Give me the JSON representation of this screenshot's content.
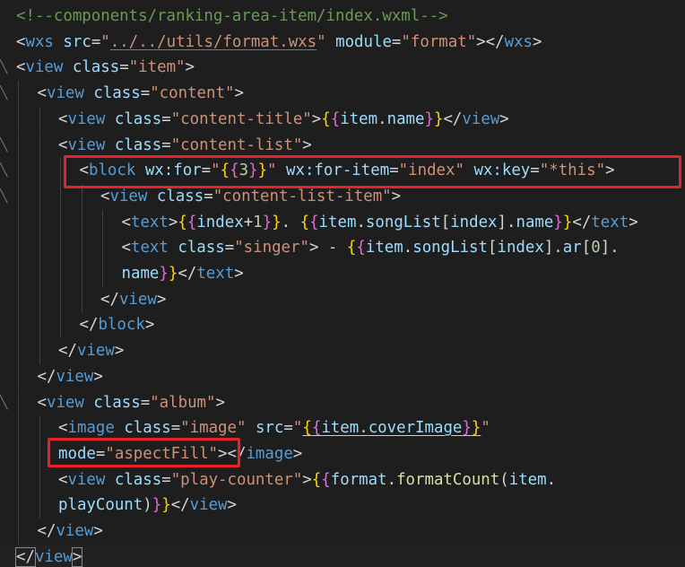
{
  "lines": [
    {
      "indent": 0,
      "fold": "",
      "tokens": [
        {
          "c": "t-comment",
          "t": "<!--components/ranking-area-item/index.wxml-->"
        }
      ]
    },
    {
      "indent": 0,
      "fold": "",
      "tokens": [
        {
          "c": "t-punc",
          "t": "<"
        },
        {
          "c": "t-tag",
          "t": "wxs"
        },
        {
          "c": "t-plain",
          "t": " "
        },
        {
          "c": "t-attr",
          "t": "src"
        },
        {
          "c": "t-plain",
          "t": "="
        },
        {
          "c": "t-str",
          "t": "\""
        },
        {
          "c": "t-str u-red",
          "t": "../../utils/format.wxs"
        },
        {
          "c": "t-str",
          "t": "\""
        },
        {
          "c": "t-plain",
          "t": " "
        },
        {
          "c": "t-attr",
          "t": "module"
        },
        {
          "c": "t-plain",
          "t": "="
        },
        {
          "c": "t-str",
          "t": "\"format\""
        },
        {
          "c": "t-punc",
          "t": "></"
        },
        {
          "c": "t-tag",
          "t": "wxs"
        },
        {
          "c": "t-punc",
          "t": ">"
        }
      ]
    },
    {
      "indent": 0,
      "fold": "v",
      "tokens": [
        {
          "c": "t-punc",
          "t": "<"
        },
        {
          "c": "t-tag",
          "t": "view"
        },
        {
          "c": "t-plain",
          "t": " "
        },
        {
          "c": "t-attr",
          "t": "class"
        },
        {
          "c": "t-plain",
          "t": "="
        },
        {
          "c": "t-str",
          "t": "\"item\""
        },
        {
          "c": "t-punc",
          "t": ">"
        }
      ]
    },
    {
      "indent": 1,
      "fold": "v",
      "tokens": [
        {
          "c": "t-punc",
          "t": "<"
        },
        {
          "c": "t-tag",
          "t": "view"
        },
        {
          "c": "t-plain",
          "t": " "
        },
        {
          "c": "t-attr",
          "t": "class"
        },
        {
          "c": "t-plain",
          "t": "="
        },
        {
          "c": "t-str",
          "t": "\"content\""
        },
        {
          "c": "t-punc",
          "t": ">"
        }
      ]
    },
    {
      "indent": 2,
      "fold": "",
      "tokens": [
        {
          "c": "t-punc",
          "t": "<"
        },
        {
          "c": "t-tag",
          "t": "view"
        },
        {
          "c": "t-plain",
          "t": " "
        },
        {
          "c": "t-attr",
          "t": "class"
        },
        {
          "c": "t-plain",
          "t": "="
        },
        {
          "c": "t-str",
          "t": "\"content-title\""
        },
        {
          "c": "t-punc",
          "t": ">"
        },
        {
          "c": "t-brace",
          "t": "{"
        },
        {
          "c": "t-brace2",
          "t": "{"
        },
        {
          "c": "t-var",
          "t": "item"
        },
        {
          "c": "t-plain",
          "t": "."
        },
        {
          "c": "t-var",
          "t": "name"
        },
        {
          "c": "t-brace2",
          "t": "}"
        },
        {
          "c": "t-brace",
          "t": "}"
        },
        {
          "c": "t-punc",
          "t": "</"
        },
        {
          "c": "t-tag",
          "t": "view"
        },
        {
          "c": "t-punc",
          "t": ">"
        }
      ]
    },
    {
      "indent": 2,
      "fold": "v",
      "tokens": [
        {
          "c": "t-punc",
          "t": "<"
        },
        {
          "c": "t-tag",
          "t": "view"
        },
        {
          "c": "t-plain",
          "t": " "
        },
        {
          "c": "t-attr",
          "t": "class"
        },
        {
          "c": "t-plain",
          "t": "="
        },
        {
          "c": "t-str",
          "t": "\"content-list\""
        },
        {
          "c": "t-punc",
          "t": ">"
        }
      ]
    },
    {
      "indent": 3,
      "fold": "v",
      "tokens": [
        {
          "c": "t-punc",
          "t": "<"
        },
        {
          "c": "t-tag",
          "t": "block"
        },
        {
          "c": "t-plain",
          "t": " "
        },
        {
          "c": "t-attr",
          "t": "wx:for"
        },
        {
          "c": "t-plain",
          "t": "="
        },
        {
          "c": "t-str",
          "t": "\""
        },
        {
          "c": "t-brace",
          "t": "{"
        },
        {
          "c": "t-brace2",
          "t": "{"
        },
        {
          "c": "t-num",
          "t": "3"
        },
        {
          "c": "t-brace2",
          "t": "}"
        },
        {
          "c": "t-brace",
          "t": "}"
        },
        {
          "c": "t-str",
          "t": "\""
        },
        {
          "c": "t-plain",
          "t": " "
        },
        {
          "c": "t-attr",
          "t": "wx:for-item"
        },
        {
          "c": "t-plain",
          "t": "="
        },
        {
          "c": "t-str",
          "t": "\"index\""
        },
        {
          "c": "t-plain",
          "t": " "
        },
        {
          "c": "t-attr",
          "t": "wx:key"
        },
        {
          "c": "t-plain",
          "t": "="
        },
        {
          "c": "t-str",
          "t": "\"*this\""
        },
        {
          "c": "t-punc",
          "t": ">"
        }
      ]
    },
    {
      "indent": 4,
      "fold": "v",
      "tokens": [
        {
          "c": "t-punc",
          "t": "<"
        },
        {
          "c": "t-tag",
          "t": "view"
        },
        {
          "c": "t-plain",
          "t": " "
        },
        {
          "c": "t-attr",
          "t": "class"
        },
        {
          "c": "t-plain",
          "t": "="
        },
        {
          "c": "t-str",
          "t": "\"content-list-item\""
        },
        {
          "c": "t-punc",
          "t": ">"
        }
      ]
    },
    {
      "indent": 5,
      "fold": "",
      "tokens": [
        {
          "c": "t-punc",
          "t": "<"
        },
        {
          "c": "t-tag",
          "t": "text"
        },
        {
          "c": "t-punc",
          "t": ">"
        },
        {
          "c": "t-brace",
          "t": "{"
        },
        {
          "c": "t-brace2",
          "t": "{"
        },
        {
          "c": "t-var",
          "t": "index"
        },
        {
          "c": "t-plain",
          "t": "+"
        },
        {
          "c": "t-num",
          "t": "1"
        },
        {
          "c": "t-brace2",
          "t": "}"
        },
        {
          "c": "t-brace",
          "t": "}"
        },
        {
          "c": "t-text",
          "t": ". "
        },
        {
          "c": "t-brace",
          "t": "{"
        },
        {
          "c": "t-brace2",
          "t": "{"
        },
        {
          "c": "t-var",
          "t": "item"
        },
        {
          "c": "t-plain",
          "t": "."
        },
        {
          "c": "t-var",
          "t": "songList"
        },
        {
          "c": "t-plain",
          "t": "["
        },
        {
          "c": "t-var",
          "t": "index"
        },
        {
          "c": "t-plain",
          "t": "]."
        },
        {
          "c": "t-var",
          "t": "name"
        },
        {
          "c": "t-brace2",
          "t": "}"
        },
        {
          "c": "t-brace",
          "t": "}"
        },
        {
          "c": "t-punc",
          "t": "</"
        },
        {
          "c": "t-tag",
          "t": "text"
        },
        {
          "c": "t-punc",
          "t": ">"
        }
      ]
    },
    {
      "indent": 5,
      "fold": "",
      "tokens": [
        {
          "c": "t-punc",
          "t": "<"
        },
        {
          "c": "t-tag",
          "t": "text"
        },
        {
          "c": "t-plain",
          "t": " "
        },
        {
          "c": "t-attr",
          "t": "class"
        },
        {
          "c": "t-plain",
          "t": "="
        },
        {
          "c": "t-str",
          "t": "\"singer\""
        },
        {
          "c": "t-punc",
          "t": ">"
        },
        {
          "c": "t-text",
          "t": " - "
        },
        {
          "c": "t-brace",
          "t": "{"
        },
        {
          "c": "t-brace2",
          "t": "{"
        },
        {
          "c": "t-var",
          "t": "item"
        },
        {
          "c": "t-plain",
          "t": "."
        },
        {
          "c": "t-var",
          "t": "songList"
        },
        {
          "c": "t-plain",
          "t": "["
        },
        {
          "c": "t-var",
          "t": "index"
        },
        {
          "c": "t-plain",
          "t": "]."
        },
        {
          "c": "t-var",
          "t": "ar"
        },
        {
          "c": "t-plain",
          "t": "["
        },
        {
          "c": "t-num",
          "t": "0"
        },
        {
          "c": "t-plain",
          "t": "]."
        }
      ]
    },
    {
      "indent": 5,
      "fold": "",
      "tokens": [
        {
          "c": "t-var",
          "t": "name"
        },
        {
          "c": "t-brace2",
          "t": "}"
        },
        {
          "c": "t-brace",
          "t": "}"
        },
        {
          "c": "t-punc",
          "t": "</"
        },
        {
          "c": "t-tag",
          "t": "text"
        },
        {
          "c": "t-punc",
          "t": ">"
        }
      ]
    },
    {
      "indent": 4,
      "fold": "",
      "tokens": [
        {
          "c": "t-punc",
          "t": "</"
        },
        {
          "c": "t-tag",
          "t": "view"
        },
        {
          "c": "t-punc",
          "t": ">"
        }
      ]
    },
    {
      "indent": 3,
      "fold": "",
      "tokens": [
        {
          "c": "t-punc",
          "t": "</"
        },
        {
          "c": "t-tag",
          "t": "block"
        },
        {
          "c": "t-punc",
          "t": ">"
        }
      ]
    },
    {
      "indent": 2,
      "fold": "",
      "tokens": [
        {
          "c": "t-punc",
          "t": "</"
        },
        {
          "c": "t-tag",
          "t": "view"
        },
        {
          "c": "t-punc",
          "t": ">"
        }
      ]
    },
    {
      "indent": 1,
      "fold": "",
      "tokens": [
        {
          "c": "t-punc",
          "t": "</"
        },
        {
          "c": "t-tag",
          "t": "view"
        },
        {
          "c": "t-punc",
          "t": ">"
        }
      ]
    },
    {
      "indent": 1,
      "fold": "v",
      "tokens": [
        {
          "c": "t-punc",
          "t": "<"
        },
        {
          "c": "t-tag",
          "t": "view"
        },
        {
          "c": "t-plain",
          "t": " "
        },
        {
          "c": "t-attr",
          "t": "class"
        },
        {
          "c": "t-plain",
          "t": "="
        },
        {
          "c": "t-str",
          "t": "\"album\""
        },
        {
          "c": "t-punc",
          "t": ">"
        }
      ]
    },
    {
      "indent": 2,
      "fold": "",
      "tokens": [
        {
          "c": "t-punc",
          "t": "<"
        },
        {
          "c": "t-tag",
          "t": "image"
        },
        {
          "c": "t-plain",
          "t": " "
        },
        {
          "c": "t-attr",
          "t": "class"
        },
        {
          "c": "t-plain",
          "t": "="
        },
        {
          "c": "t-str",
          "t": "\"image\""
        },
        {
          "c": "t-plain",
          "t": " "
        },
        {
          "c": "t-attr",
          "t": "src"
        },
        {
          "c": "t-plain",
          "t": "="
        },
        {
          "c": "t-str",
          "t": "\""
        },
        {
          "c": "t-brace u-blue",
          "t": "{"
        },
        {
          "c": "t-brace2 u-blue",
          "t": "{"
        },
        {
          "c": "t-var u-blue",
          "t": "item"
        },
        {
          "c": "t-plain u-blue",
          "t": "."
        },
        {
          "c": "t-var u-blue",
          "t": "coverImage"
        },
        {
          "c": "t-brace2 u-blue",
          "t": "}"
        },
        {
          "c": "t-brace u-blue",
          "t": "}"
        },
        {
          "c": "t-str",
          "t": "\""
        }
      ]
    },
    {
      "indent": 2,
      "fold": "",
      "tokens": [
        {
          "c": "t-attr",
          "t": "mode"
        },
        {
          "c": "t-plain",
          "t": "="
        },
        {
          "c": "t-str",
          "t": "\"aspectFill\""
        },
        {
          "c": "t-punc",
          "t": "></"
        },
        {
          "c": "t-tag",
          "t": "image"
        },
        {
          "c": "t-punc",
          "t": ">"
        }
      ]
    },
    {
      "indent": 2,
      "fold": "",
      "tokens": [
        {
          "c": "t-punc",
          "t": "<"
        },
        {
          "c": "t-tag",
          "t": "view"
        },
        {
          "c": "t-plain",
          "t": " "
        },
        {
          "c": "t-attr",
          "t": "class"
        },
        {
          "c": "t-plain",
          "t": "="
        },
        {
          "c": "t-str",
          "t": "\"play-counter\""
        },
        {
          "c": "t-punc",
          "t": ">"
        },
        {
          "c": "t-brace",
          "t": "{"
        },
        {
          "c": "t-brace2",
          "t": "{"
        },
        {
          "c": "t-var",
          "t": "format"
        },
        {
          "c": "t-plain",
          "t": "."
        },
        {
          "c": "t-func",
          "t": "formatCount"
        },
        {
          "c": "t-plain",
          "t": "("
        },
        {
          "c": "t-var",
          "t": "item"
        },
        {
          "c": "t-plain",
          "t": "."
        }
      ]
    },
    {
      "indent": 2,
      "fold": "",
      "tokens": [
        {
          "c": "t-var",
          "t": "playCount"
        },
        {
          "c": "t-plain",
          "t": ")"
        },
        {
          "c": "t-brace2",
          "t": "}"
        },
        {
          "c": "t-brace",
          "t": "}"
        },
        {
          "c": "t-punc",
          "t": "</"
        },
        {
          "c": "t-tag",
          "t": "view"
        },
        {
          "c": "t-punc",
          "t": ">"
        }
      ]
    },
    {
      "indent": 1,
      "fold": "",
      "tokens": [
        {
          "c": "t-punc",
          "t": "</"
        },
        {
          "c": "t-tag",
          "t": "view"
        },
        {
          "c": "t-punc",
          "t": ">"
        }
      ]
    },
    {
      "indent": 0,
      "fold": "",
      "tokens": [
        {
          "c": "t-punc cursor-tag",
          "t": "</"
        },
        {
          "c": "t-tag",
          "t": "view"
        },
        {
          "c": "t-punc cursor-tag",
          "t": ">"
        }
      ]
    }
  ],
  "highlight_color": "#e8212b"
}
